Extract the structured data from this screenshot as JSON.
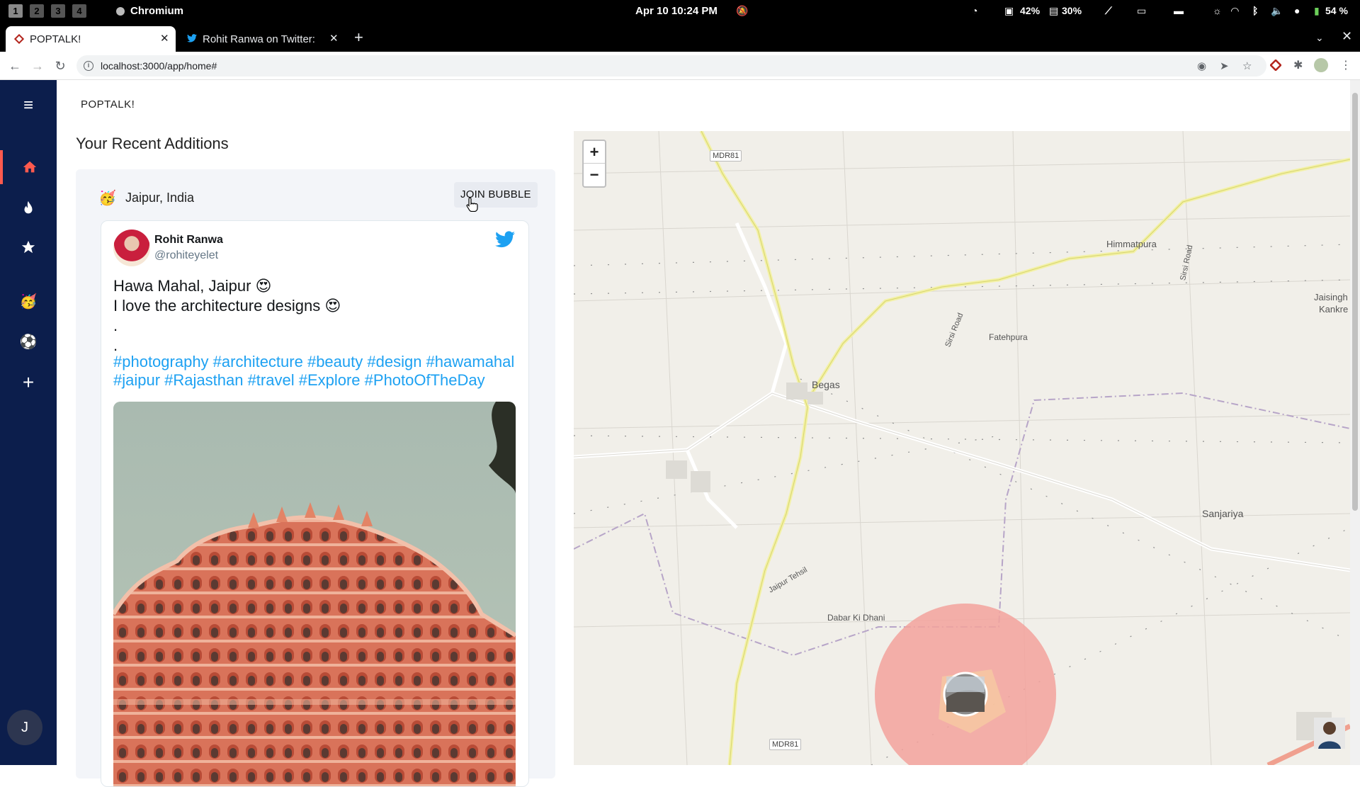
{
  "os_bar": {
    "workspaces": [
      "1",
      "2",
      "3",
      "4"
    ],
    "app_name": "Chromium",
    "clock": "Apr 10  10:24 PM",
    "indicators": {
      "cpu": "42%",
      "memory": "30%",
      "battery": "54 %"
    }
  },
  "browser": {
    "tabs": [
      {
        "title": "POPTALK!",
        "active": true
      },
      {
        "title": "Rohit Ranwa on Twitter:",
        "active": false
      }
    ],
    "url": "localhost:3000/app/home#"
  },
  "app": {
    "brand": "POPTALK!",
    "section_title": "Your Recent Additions",
    "rail": {
      "items": [
        "home",
        "fire",
        "star",
        "party-emoji",
        "soccer-ball",
        "add"
      ],
      "avatar_initial": "J",
      "active_color": "#ff5a4e",
      "rail_color": "#0c1e4c"
    },
    "card": {
      "emoji": "🥳",
      "location": "Jaipur, India",
      "join_label": "JOIN BUBBLE",
      "tweet": {
        "name": "Rohit Ranwa",
        "handle": "@rohiteyelet",
        "line1": "Hawa Mahal, Jaipur 😍",
        "line2": "I love the architecture designs 😍",
        "line3": ".",
        "line4": ".",
        "hashtags_line1": "#photography #architecture #beauty #design #hawamahal",
        "hashtags_line2": "#jaipur #Rajasthan #travel #Explore #PhotoOfTheDay"
      }
    },
    "map": {
      "zoom_in": "+",
      "zoom_out": "−",
      "labels": {
        "mdr81_top": "MDR81",
        "mdr81_bottom": "MDR81",
        "himmatpura": "Himmatpura",
        "sirsi_road_1": "Sirsi Road",
        "sirsi_road_2": "Sirsi Road",
        "jaisingh": "Jaisingh",
        "kankre": "Kankre",
        "fatehpura": "Fatehpura",
        "begas": "Begas",
        "sanjariya": "Sanjariya",
        "jaipur_tehsil": "Jaipur Tehsil",
        "dabar_ki_dhani": "Dabar Ki Dhani"
      },
      "bubble_color": "#f3a29c"
    }
  }
}
